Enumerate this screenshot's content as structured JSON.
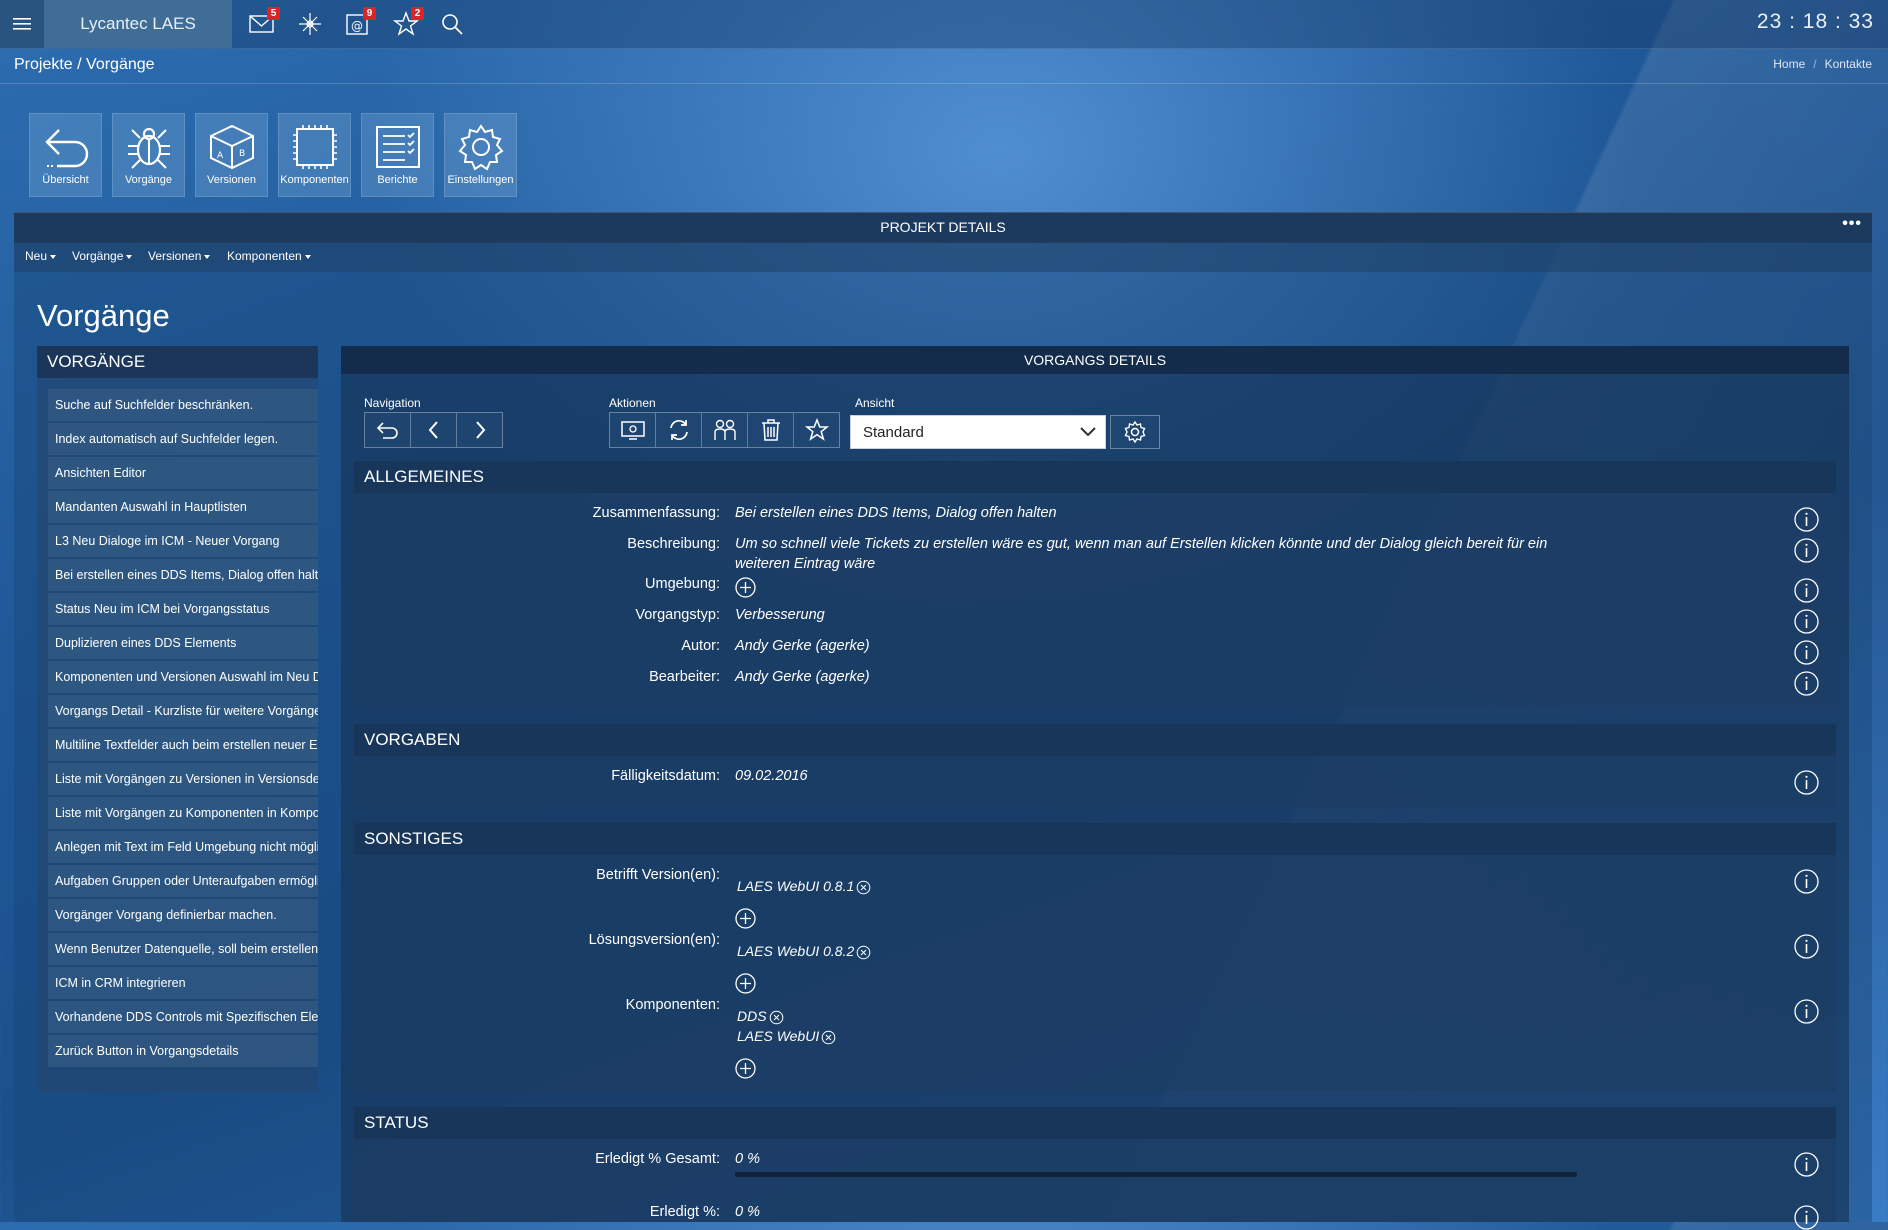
{
  "app": {
    "name": "Lycantec LAES",
    "clock": "23 : 18 : 33"
  },
  "topbar": {
    "icons": [
      {
        "name": "mail-icon",
        "badge": "5"
      },
      {
        "name": "sparkle-icon",
        "badge": ""
      },
      {
        "name": "at-mail-icon",
        "badge": "9"
      },
      {
        "name": "star-icon",
        "badge": "2"
      },
      {
        "name": "search-icon",
        "badge": ""
      }
    ]
  },
  "breadcrumb": {
    "title": "Projekte / Vorgänge",
    "links": [
      "Home",
      "Kontakte"
    ]
  },
  "tiles": [
    "Übersicht",
    "Vorgänge",
    "Versionen",
    "Komponenten",
    "Berichte",
    "Einstellungen"
  ],
  "project": {
    "title": "PROJEKT DETAILS",
    "dots": "•••",
    "menu": [
      "Neu",
      "Vorgänge",
      "Versionen",
      "Komponenten"
    ]
  },
  "page_title": "Vorgänge",
  "left_panel": {
    "title": "VORGÄNGE",
    "items": [
      "Suche auf Suchfelder beschränken.",
      "Index automatisch auf Suchfelder legen.",
      "Ansichten Editor",
      "Mandanten Auswahl in Hauptlisten",
      "L3 Neu Dialoge im ICM - Neuer Vorgang",
      "Bei erstellen eines DDS Items, Dialog offen halten",
      "Status Neu im ICM bei Vorgangsstatus",
      "Duplizieren eines DDS Elements",
      "Komponenten und Versionen Auswahl im Neu Dialog",
      "Vorgangs Detail - Kurzliste für weitere Vorgänge",
      "Multiline Textfelder auch beim erstellen neuer Elemente",
      "Liste mit Vorgängen zu Versionen in Versionsdetails",
      "Liste mit Vorgängen zu Komponenten in Komponentendetails",
      "Anlegen mit Text im Feld Umgebung nicht möglich",
      "Aufgaben Gruppen oder Unteraufgaben ermöglichen",
      "Vorgänger Vorgang definierbar machen.",
      "Wenn Benutzer Datenquelle, soll beim erstellen der",
      "ICM in CRM integrieren",
      "Vorhandene DDS Controls mit Spezifischen Elementen",
      "Zurück Button in Vorgangsdetails"
    ]
  },
  "details": {
    "title": "VORGANGS DETAILS",
    "groups": {
      "navigation": "Navigation",
      "actions": "Aktionen",
      "view": "Ansicht"
    },
    "view_selected": "Standard"
  },
  "sections": {
    "allgemeines": {
      "title": "ALLGEMEINES",
      "fields": {
        "zusammenfassung_label": "Zusammenfassung:",
        "zusammenfassung_value": "Bei erstellen eines DDS Items, Dialog offen halten",
        "beschreibung_label": "Beschreibung:",
        "beschreibung_line1": "Um so schnell viele Tickets zu erstellen wäre es gut, wenn man auf Erstellen klicken könnte und der Dialog gleich bereit für ein",
        "beschreibung_line2": "weiteren Eintrag wäre",
        "umgebung_label": "Umgebung:",
        "vorgangstyp_label": "Vorgangstyp:",
        "vorgangstyp_value": "Verbesserung",
        "autor_label": "Autor:",
        "autor_value": "Andy Gerke (agerke)",
        "bearbeiter_label": "Bearbeiter:",
        "bearbeiter_value": "Andy Gerke (agerke)"
      }
    },
    "vorgaben": {
      "title": "VORGABEN",
      "faelligkeit_label": "Fälligkeitsdatum:",
      "faelligkeit_value": "09.02.2016"
    },
    "sonstiges": {
      "title": "SONSTIGES",
      "betrifft_label": "Betrifft Version(en):",
      "betrifft_chips": [
        "LAES WebUI 0.8.1"
      ],
      "loesung_label": "Lösungsversion(en):",
      "loesung_chips": [
        "LAES WebUI 0.8.2"
      ],
      "komponenten_label": "Komponenten:",
      "komponenten_chips": [
        "DDS",
        "LAES WebUI"
      ]
    },
    "status": {
      "title": "STATUS",
      "gesamt_label": "Erledigt % Gesamt:",
      "gesamt_value": "0 %",
      "gesamt_progress": 0,
      "erledigt_label": "Erledigt %:",
      "erledigt_value": "0 %"
    }
  }
}
